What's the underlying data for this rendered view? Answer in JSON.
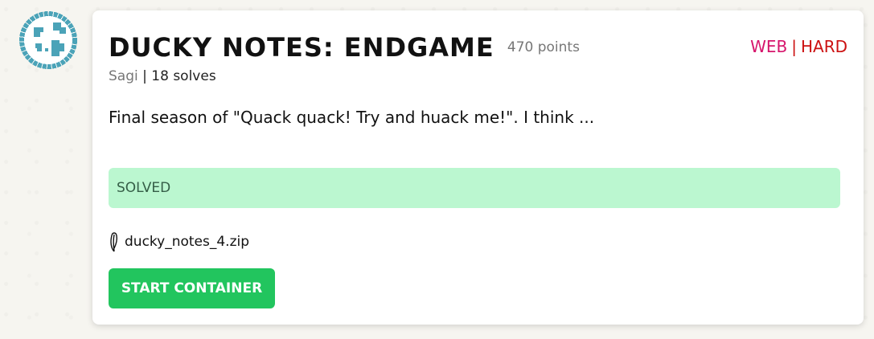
{
  "challenge": {
    "title": "DUCKY NOTES: ENDGAME",
    "points": "470 points",
    "category": "WEB",
    "separator": "|",
    "difficulty": "HARD",
    "author": "Sagi",
    "meta_separator": "|",
    "solves": "18 solves",
    "description": "Final season of \"Quack quack! Try and huack me!\". I think ...",
    "status": "SOLVED",
    "attachment": "ducky_notes_4.zip",
    "action_label": "START CONTAINER",
    "category_icon": "globe-icon",
    "attachment_icon": "paperclip-icon"
  },
  "colors": {
    "category": "#d6156c",
    "difficulty": "#cc1111",
    "status_bg": "#bbf7d0",
    "button_bg": "#22c55e",
    "icon": "#4ba3b8"
  }
}
